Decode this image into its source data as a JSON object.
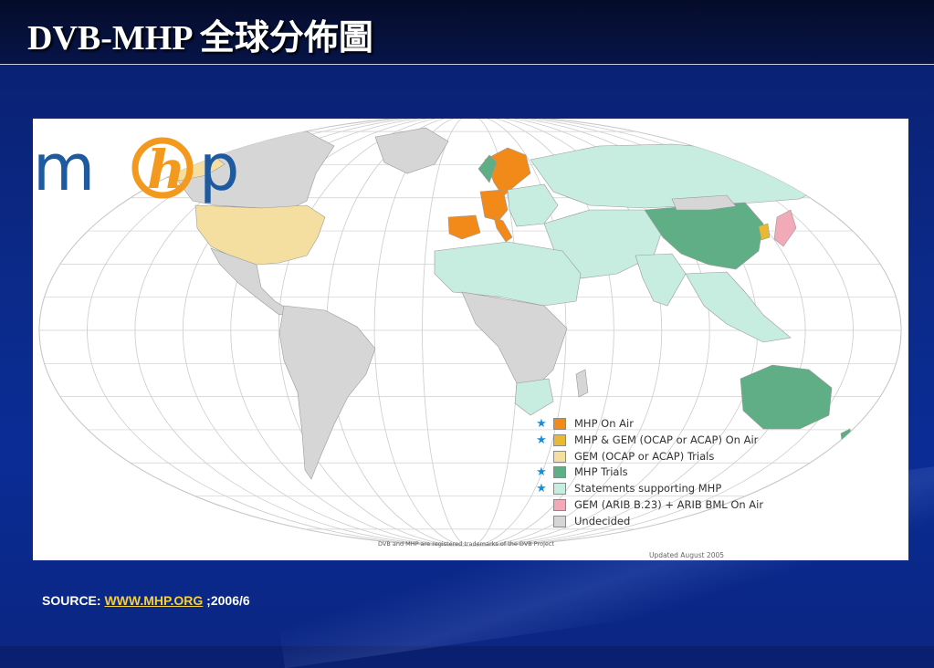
{
  "slide": {
    "title": "DVB-MHP 全球分佈圖"
  },
  "map": {
    "footnote": "DVB and MHP are registered trademarks of the DVB Project",
    "updated": "Updated August 2005",
    "colors": {
      "ocean": "#ffffff",
      "grid": "#c9c9c9",
      "border": "#9a9a9a",
      "mhp_on_air": "#f28a1a",
      "mhp_gem_on_air": "#e8b932",
      "gem_trials": "#f5dfa0",
      "mhp_trials": "#5fae86",
      "statements": "#c7ece0",
      "gem_arib": "#f2a9b8",
      "undecided": "#d6d6d6"
    },
    "legend": [
      {
        "label": "MHP On Air",
        "color": "#f28a1a",
        "star": "★"
      },
      {
        "label": "MHP & GEM (OCAP or ACAP) On Air",
        "color": "#e8b932",
        "star": "★"
      },
      {
        "label": "GEM (OCAP or ACAP) Trials",
        "color": "#f5dfa0",
        "star": ""
      },
      {
        "label": "MHP Trials",
        "color": "#5fae86",
        "star": "★"
      },
      {
        "label": "Statements supporting MHP",
        "color": "#c7ece0",
        "star": "★"
      },
      {
        "label": "GEM (ARIB B.23) + ARIB BML On Air",
        "color": "#f2a9b8",
        "star": ""
      },
      {
        "label": "Undecided",
        "color": "#d6d6d6",
        "star": ""
      }
    ]
  },
  "logo": {
    "text_m": "m",
    "text_h": "h",
    "text_p": "p",
    "colors": {
      "blue": "#1e5aa0",
      "orange": "#f39a1e"
    }
  },
  "source": {
    "prefix": "SOURCE: ",
    "link": "WWW.MHP.ORG",
    "suffix": " ;2006/6"
  }
}
